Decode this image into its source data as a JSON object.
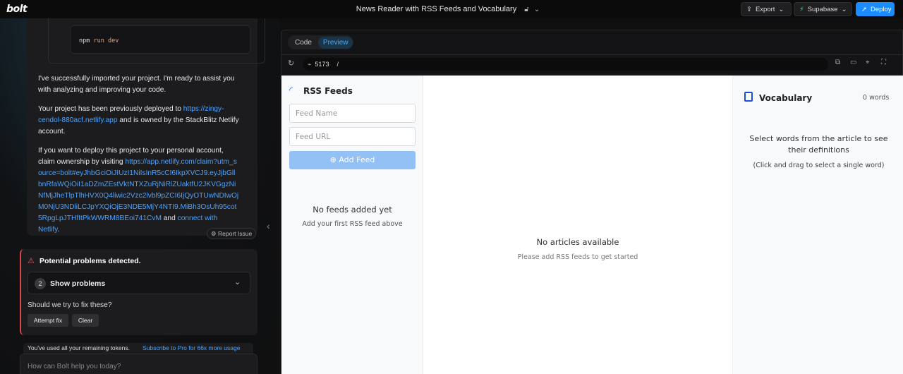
{
  "topbar": {
    "logo": "bolt",
    "project_title": "News Reader with RSS Feeds and Vocabulary",
    "export_label": "Export",
    "supabase_label": "Supabase",
    "deploy_label": "Deploy"
  },
  "chat": {
    "code_cmd": "npm",
    "code_args": "run dev",
    "p1": "I've successfully imported your project. I'm ready to assist you with analyzing and improving your code.",
    "p2_pre": "Your project has been previously deployed to ",
    "p2_link": "https://zingy-cendol-880acf.netlify.app",
    "p2_post": " and is owned by the StackBlitz Netlify account.",
    "p3_pre": "If you want to deploy this project to your personal account, claim ownership by visiting ",
    "p3_link": "https://app.netlify.com/claim?utm_source=bolt#eyJhbGciOiJIUzI1NiIsInR5cCI6IkpXVCJ9.eyJjbGllbnRfaWQiOiI1aDZmZEstVktNTXZuRjNiRlZUaktfU2JKVGgzNiNfMjJheTlpTlhHVX0Q4liwic2Vzc2lvbl9pZCI6IjQyOTUwNDIwOjM0NjU3NDliLCJpYXQiOjE3NDE5MjY4NTI9.MiBh3OsUh95cot5RpgLpJTHfItPkWWRM8BEoi741CvM",
    "p3_and": " and ",
    "p3_link2": "connect with Netlify",
    "p3_end": ".",
    "report_label": "Report Issue"
  },
  "problems": {
    "title": "Potential problems detected.",
    "count": "2",
    "show_label": "Show problems",
    "question": "Should we try to fix these?",
    "attempt_label": "Attempt fix",
    "clear_label": "Clear"
  },
  "tokens": {
    "text": "You've used all your remaining tokens.",
    "link": "Subscribe to Pro for 66x more usage"
  },
  "input": {
    "placeholder": "How can Bolt help you today?"
  },
  "workbench": {
    "tab_code": "Code",
    "tab_preview": "Preview",
    "port": "5173",
    "path": "/"
  },
  "preview": {
    "feeds_title": "RSS Feeds",
    "feed_name_placeholder": "Feed Name",
    "feed_url_placeholder": "Feed URL",
    "add_feed_label": "Add Feed",
    "no_feeds": "No feeds added yet",
    "no_feeds_sub": "Add your first RSS feed above",
    "no_articles": "No articles available",
    "no_articles_sub": "Please add RSS feeds to get started",
    "vocab_title": "Vocabulary",
    "word_count": "0 words",
    "vocab_help": "Select words from the article to see their definitions",
    "vocab_sub": "(Click and drag to select a single word)"
  },
  "colors": {
    "accent": "#1a8cff",
    "link": "#4aa3ff",
    "error": "#e04444",
    "add_feed_bg": "#93c0f5"
  }
}
